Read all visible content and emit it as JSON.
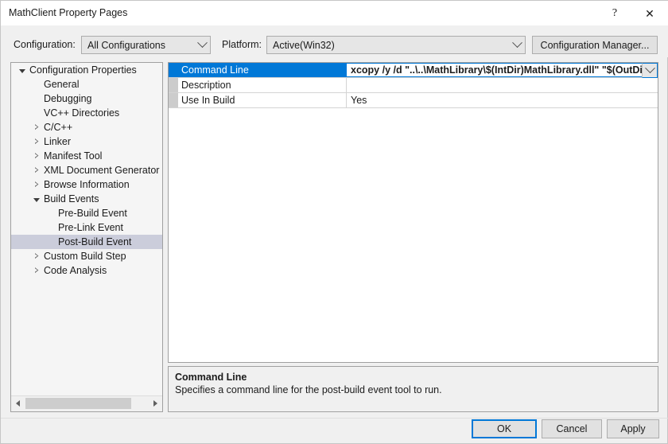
{
  "window": {
    "title": "MathClient Property Pages",
    "help_glyph": "?",
    "close_glyph": "✕"
  },
  "toolbar": {
    "configuration_label": "Configuration:",
    "configuration_value": "All Configurations",
    "platform_label": "Platform:",
    "platform_value": "Active(Win32)",
    "configuration_manager_label": "Configuration Manager..."
  },
  "tree": {
    "selected": "Post-Build Event",
    "items": [
      {
        "label": "Configuration Properties",
        "depth": 0,
        "state": "expanded"
      },
      {
        "label": "General",
        "depth": 1,
        "state": "leaf"
      },
      {
        "label": "Debugging",
        "depth": 1,
        "state": "leaf"
      },
      {
        "label": "VC++ Directories",
        "depth": 1,
        "state": "leaf"
      },
      {
        "label": "C/C++",
        "depth": 1,
        "state": "collapsed"
      },
      {
        "label": "Linker",
        "depth": 1,
        "state": "collapsed"
      },
      {
        "label": "Manifest Tool",
        "depth": 1,
        "state": "collapsed"
      },
      {
        "label": "XML Document Generator",
        "depth": 1,
        "state": "collapsed"
      },
      {
        "label": "Browse Information",
        "depth": 1,
        "state": "collapsed"
      },
      {
        "label": "Build Events",
        "depth": 1,
        "state": "expanded"
      },
      {
        "label": "Pre-Build Event",
        "depth": 2,
        "state": "leaf"
      },
      {
        "label": "Pre-Link Event",
        "depth": 2,
        "state": "leaf"
      },
      {
        "label": "Post-Build Event",
        "depth": 2,
        "state": "leaf",
        "selected": true
      },
      {
        "label": "Custom Build Step",
        "depth": 1,
        "state": "collapsed"
      },
      {
        "label": "Code Analysis",
        "depth": 1,
        "state": "collapsed"
      }
    ],
    "scrollbar": {
      "left_arrow": "‹",
      "right_arrow": "›"
    }
  },
  "grid": {
    "rows": [
      {
        "name": "Command Line",
        "value": "xcopy /y /d \"..\\..\\MathLibrary\\$(IntDir)MathLibrary.dll\" \"$(OutDir)\"",
        "selected": true,
        "has_dropdown": true
      },
      {
        "name": "Description",
        "value": "",
        "selected": false,
        "has_dropdown": false
      },
      {
        "name": "Use In Build",
        "value": "Yes",
        "selected": false,
        "has_dropdown": false
      }
    ]
  },
  "description": {
    "title": "Command Line",
    "text": "Specifies a command line for the post-build event tool to run."
  },
  "footer": {
    "ok_label": "OK",
    "cancel_label": "Cancel",
    "apply_label": "Apply"
  },
  "colors": {
    "selection_blue": "#0078D7",
    "tree_selection": "#CBCDDB",
    "dialog_background": "#F0F0F0"
  }
}
